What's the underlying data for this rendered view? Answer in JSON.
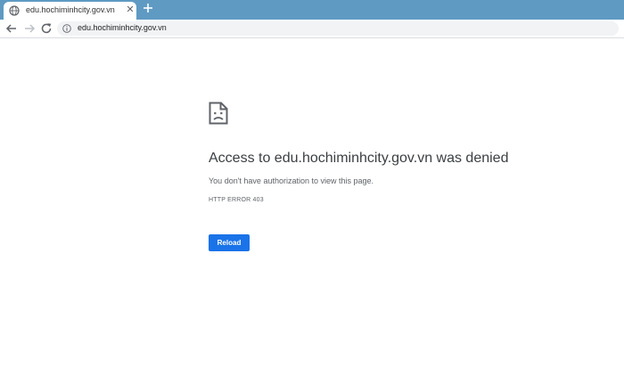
{
  "browser": {
    "tab": {
      "title": "edu.hochiminhcity.gov.vn",
      "favicon_icon": "globe-icon",
      "close_icon": "close-icon"
    },
    "new_tab_icon": "plus-icon",
    "toolbar": {
      "back_icon": "back-arrow-icon",
      "forward_icon": "forward-arrow-icon",
      "reload_icon": "reload-icon",
      "site_info_icon": "info-icon",
      "url": "edu.hochiminhcity.gov.vn"
    },
    "colors": {
      "tabstrip": "#5f9ac3",
      "button_blue": "#1a73e8"
    }
  },
  "error_page": {
    "icon": "sad-document-icon",
    "title": "Access to edu.hochiminhcity.gov.vn was denied",
    "description": "You don't have authorization to view this page.",
    "error_code": "HTTP ERROR 403",
    "reload_label": "Reload"
  }
}
